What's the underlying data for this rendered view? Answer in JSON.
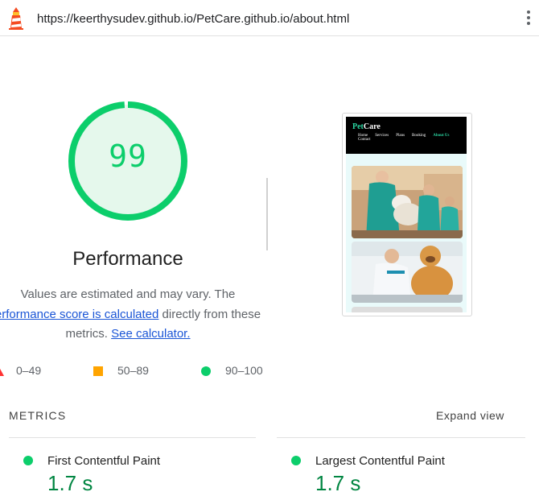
{
  "header": {
    "url": "https://keerthysudev.github.io/PetCare.github.io/about.html",
    "logo_icon": "lighthouse-icon",
    "menu_icon": "kebab-menu-icon"
  },
  "gauge": {
    "score": 99,
    "score_text": "99",
    "title": "Performance",
    "color": "#0cce6b",
    "fill_fraction": 0.99
  },
  "description": {
    "text_1": "Values are estimated and may vary. The",
    "link_1": "erformance score is calculated",
    "text_2": " directly from these",
    "text_3": "metrics. ",
    "link_2": "See calculator."
  },
  "legend": {
    "fail": "0–49",
    "average": "50–89",
    "pass": "90–100",
    "colors": {
      "fail": "#ff3333",
      "average": "#ffa400",
      "pass": "#0cce6b"
    }
  },
  "screenshot": {
    "brand_pet": "Pet",
    "brand_care": "Care",
    "nav": [
      "Home",
      "Services",
      "Plans",
      "Booking",
      "About Us",
      "Contact"
    ],
    "active_nav": "About Us"
  },
  "metrics": {
    "heading": "METRICS",
    "expand_label": "Expand view",
    "items": [
      {
        "label": "First Contentful Paint",
        "value": "1.7 s",
        "status": "pass"
      },
      {
        "label": "Largest Contentful Paint",
        "value": "1.7 s",
        "status": "pass"
      }
    ]
  }
}
